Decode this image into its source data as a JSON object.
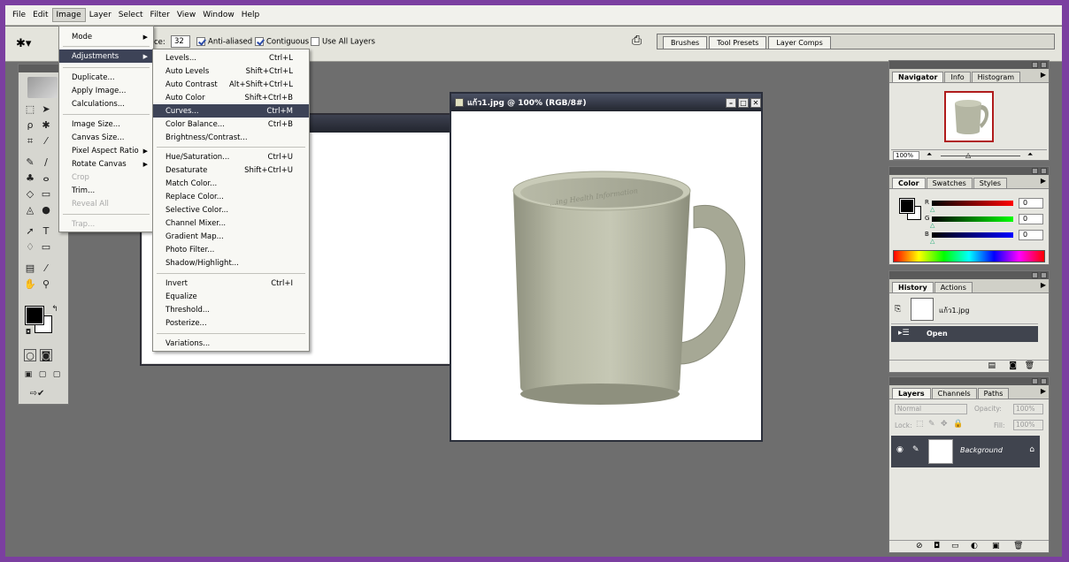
{
  "menubar": {
    "items": [
      "File",
      "Edit",
      "Image",
      "Layer",
      "Select",
      "Filter",
      "View",
      "Window",
      "Help"
    ],
    "active": "Image"
  },
  "options": {
    "tolerance_label": "ce:",
    "tolerance_value": "32",
    "anti_aliased": "Anti-aliased",
    "contiguous": "Contiguous",
    "use_all_layers": "Use All Layers"
  },
  "palette_well": {
    "tabs": [
      "Brushes",
      "Tool Presets",
      "Layer Comps"
    ]
  },
  "image_menu": {
    "items": [
      {
        "label": "Mode",
        "arrow": true
      },
      {
        "label": "Adjustments",
        "arrow": true,
        "highlight": true
      },
      {
        "label": "Duplicate..."
      },
      {
        "label": "Apply Image..."
      },
      {
        "label": "Calculations..."
      },
      {
        "label": "Image Size..."
      },
      {
        "label": "Canvas Size..."
      },
      {
        "label": "Pixel Aspect Ratio",
        "arrow": true
      },
      {
        "label": "Rotate Canvas",
        "arrow": true
      },
      {
        "label": "Crop",
        "disabled": true
      },
      {
        "label": "Trim..."
      },
      {
        "label": "Reveal All",
        "disabled": true
      },
      {
        "label": "Trap...",
        "disabled": true
      }
    ]
  },
  "adjustments_menu": {
    "items": [
      {
        "label": "Levels...",
        "shortcut": "Ctrl+L"
      },
      {
        "label": "Auto Levels",
        "shortcut": "Shift+Ctrl+L"
      },
      {
        "label": "Auto Contrast",
        "shortcut": "Alt+Shift+Ctrl+L"
      },
      {
        "label": "Auto Color",
        "shortcut": "Shift+Ctrl+B"
      },
      {
        "label": "Curves...",
        "shortcut": "Ctrl+M",
        "highlight": true
      },
      {
        "label": "Color Balance...",
        "shortcut": "Ctrl+B"
      },
      {
        "label": "Brightness/Contrast...",
        "shortcut": ""
      },
      {
        "label": "Hue/Saturation...",
        "shortcut": "Ctrl+U"
      },
      {
        "label": "Desaturate",
        "shortcut": "Shift+Ctrl+U"
      },
      {
        "label": "Match Color...",
        "shortcut": ""
      },
      {
        "label": "Replace Color...",
        "shortcut": ""
      },
      {
        "label": "Selective Color...",
        "shortcut": ""
      },
      {
        "label": "Channel Mixer...",
        "shortcut": ""
      },
      {
        "label": "Gradient Map...",
        "shortcut": ""
      },
      {
        "label": "Photo Filter...",
        "shortcut": ""
      },
      {
        "label": "Shadow/Highlight...",
        "shortcut": ""
      },
      {
        "label": "Invert",
        "shortcut": "Ctrl+I"
      },
      {
        "label": "Equalize",
        "shortcut": ""
      },
      {
        "label": "Threshold...",
        "shortcut": ""
      },
      {
        "label": "Posterize...",
        "shortcut": ""
      },
      {
        "label": "Variations...",
        "shortcut": ""
      }
    ]
  },
  "document": {
    "title": "แก้ว1.jpg @ 100% (RGB/8#)",
    "mug_text": "...ing Health Information"
  },
  "navigator": {
    "tabs": [
      "Navigator",
      "Info",
      "Histogram"
    ],
    "zoom": "100%"
  },
  "color": {
    "tabs": [
      "Color",
      "Swatches",
      "Styles"
    ],
    "r_label": "R",
    "g_label": "G",
    "b_label": "B",
    "r": "0",
    "g": "0",
    "b": "0",
    "fg": "#000000",
    "bg": "#ffffff"
  },
  "history": {
    "tabs": [
      "History",
      "Actions"
    ],
    "snapshot": "แก้ว1.jpg",
    "state": "Open"
  },
  "layers": {
    "tabs": [
      "Layers",
      "Channels",
      "Paths"
    ],
    "blend_mode": "Normal",
    "opacity_label": "Opacity:",
    "opacity": "100%",
    "lock_label": "Lock:",
    "fill_label": "Fill:",
    "fill": "100%",
    "layer_name": "Background"
  },
  "colors": {
    "menu_highlight": "#3d4357",
    "workspace": "#6e6e6e",
    "outer_border": "#7b3fa0"
  }
}
